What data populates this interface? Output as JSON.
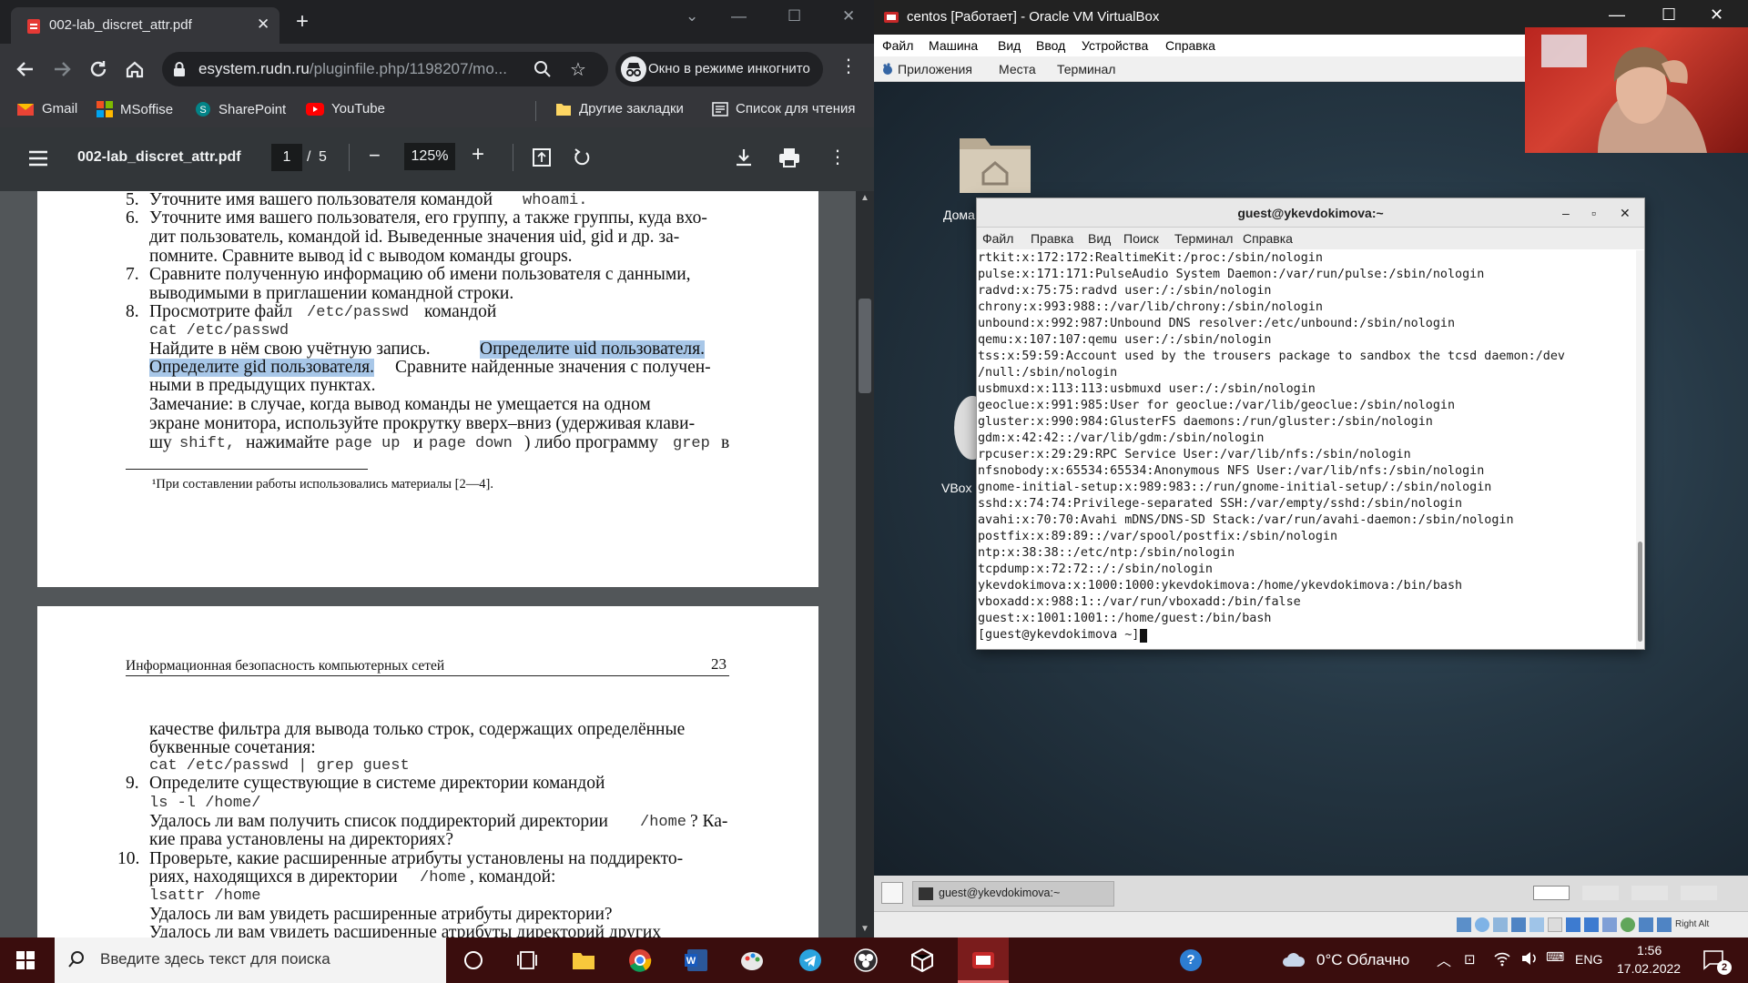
{
  "chrome": {
    "tab_title": "002-lab_discret_attr.pdf",
    "url_host": "esystem.rudn.ru",
    "url_path": "/pluginfile.php/1198207/mo...",
    "incognito_label": "Окно в режиме инкогнито",
    "bookmarks": [
      "Gmail",
      "MSoffise",
      "SharePoint",
      "YouTube"
    ],
    "other_bookmarks": "Другие закладки",
    "reading_list": "Список для чтения"
  },
  "pdf": {
    "filename": "002-lab_discret_attr.pdf",
    "page_current": "1",
    "page_sep": "/",
    "page_total": "5",
    "zoom": "125%",
    "page1": {
      "l1a": "5.",
      "l1b": "Уточните имя вашего пользователя командой",
      "l1c": "whoami.",
      "l2a": "6.",
      "l2b": "Уточните имя вашего пользователя, его группу, а также группы, куда вхо-",
      "l3": "дит пользователь, командой id. Выведенные значения uid, gid и др. за-",
      "l4": "помните. Сравните вывод id с выводом команды groups.",
      "l5a": "7.",
      "l5b": "Сравните полученную информацию об имени пользователя с данными,",
      "l6": "выводимыми в приглашении командной строки.",
      "l7a": "8.",
      "l7b": "Просмотрите файл",
      "l7c": "/etc/passwd",
      "l7d": "командой",
      "l8": "cat /etc/passwd",
      "l9a": "Найдите в нём свою учётную запись.",
      "l9b": "Определите uid пользователя.",
      "l10a": "Определите gid пользователя.",
      "l10b": "Сравните найденные значения с получен-",
      "l11": "ными в предыдущих пунктах.",
      "l12": "Замечание: в случае, когда вывод команды не умещается на одном",
      "l13": "экране монитора, используйте прокрутку вверх–вниз (удерживая клави-",
      "l14a": "шу",
      "l14b": "shift,",
      "l14c": "нажимайте",
      "l14d": "page up",
      "l14e": "и",
      "l14f": "page down",
      "l14g": ") либо программу",
      "l14h": "grep",
      "l14i": "в",
      "footnote": "¹При составлении работы использовались материалы [2—4]."
    },
    "page2": {
      "header_left": "Информационная безопасность компьютерных сетей",
      "header_right": "23",
      "l1": "качестве фильтра для вывода только строк, содержащих определённые",
      "l2": "буквенные сочетания:",
      "l3": "cat /etc/passwd | grep guest",
      "l4a": "9.",
      "l4b": "Определите существующие в системе директории командой",
      "l5": "ls -l /home/",
      "l6a": "Удалось ли вам получить список поддиректорий директории",
      "l6b": "/home",
      "l6c": "? Ка-",
      "l7": "кие права установлены на директориях?",
      "l8a": "10.",
      "l8b": "Проверьте, какие расширенные атрибуты установлены на поддиректо-",
      "l9a": "риях, находящихся в директории",
      "l9b": "/home",
      "l9c": ", командой:",
      "l10": "lsattr /home",
      "l11": "Удалось ли вам увидеть расширенные атрибуты директории?",
      "l12": "Удалось ли вам увидеть расширенные атрибуты директорий других"
    }
  },
  "vbox": {
    "title": "centos [Работает] - Oracle VM VirtualBox",
    "menu": [
      "Файл",
      "Машина",
      "Вид",
      "Ввод",
      "Устройства",
      "Справка"
    ],
    "gnome_menu": [
      "Приложения",
      "Места",
      "Терминал"
    ],
    "desktop_icons": [
      "Дома",
      "VBox"
    ],
    "taskbar_item": "guest@ykevdokimova:~",
    "right_alt": "Right Alt"
  },
  "terminal": {
    "title": "guest@ykevdokimova:~",
    "menu": [
      "Файл",
      "Правка",
      "Вид",
      "Поиск",
      "Терминал",
      "Справка"
    ],
    "lines": [
      "rtkit:x:172:172:RealtimeKit:/proc:/sbin/nologin",
      "pulse:x:171:171:PulseAudio System Daemon:/var/run/pulse:/sbin/nologin",
      "radvd:x:75:75:radvd user:/:/sbin/nologin",
      "chrony:x:993:988::/var/lib/chrony:/sbin/nologin",
      "unbound:x:992:987:Unbound DNS resolver:/etc/unbound:/sbin/nologin",
      "qemu:x:107:107:qemu user:/:/sbin/nologin",
      "tss:x:59:59:Account used by the trousers package to sandbox the tcsd daemon:/dev",
      "/null:/sbin/nologin",
      "usbmuxd:x:113:113:usbmuxd user:/:/sbin/nologin",
      "geoclue:x:991:985:User for geoclue:/var/lib/geoclue:/sbin/nologin",
      "gluster:x:990:984:GlusterFS daemons:/run/gluster:/sbin/nologin",
      "gdm:x:42:42::/var/lib/gdm:/sbin/nologin",
      "rpcuser:x:29:29:RPC Service User:/var/lib/nfs:/sbin/nologin",
      "nfsnobody:x:65534:65534:Anonymous NFS User:/var/lib/nfs:/sbin/nologin",
      "gnome-initial-setup:x:989:983::/run/gnome-initial-setup/:/sbin/nologin",
      "sshd:x:74:74:Privilege-separated SSH:/var/empty/sshd:/sbin/nologin",
      "avahi:x:70:70:Avahi mDNS/DNS-SD Stack:/var/run/avahi-daemon:/sbin/nologin",
      "postfix:x:89:89::/var/spool/postfix:/sbin/nologin",
      "ntp:x:38:38::/etc/ntp:/sbin/nologin",
      "tcpdump:x:72:72::/:/sbin/nologin",
      "ykevdokimova:x:1000:1000:ykevdokimova:/home/ykevdokimova:/bin/bash",
      "vboxadd:x:988:1::/var/run/vboxadd:/bin/false",
      "guest:x:1001:1001::/home/guest:/bin/bash",
      "[guest@ykevdokimova ~]$ "
    ]
  },
  "taskbar": {
    "search_placeholder": "Введите здесь текст для поиска",
    "weather": "0°C Облачно",
    "lang": "ENG",
    "time": "1:56",
    "date": "17.02.2022",
    "notif_count": "2"
  },
  "colors": {
    "taskbar": "#3a0d0d",
    "highlight": "#a8c7e8",
    "chrome_dark": "#202124"
  }
}
